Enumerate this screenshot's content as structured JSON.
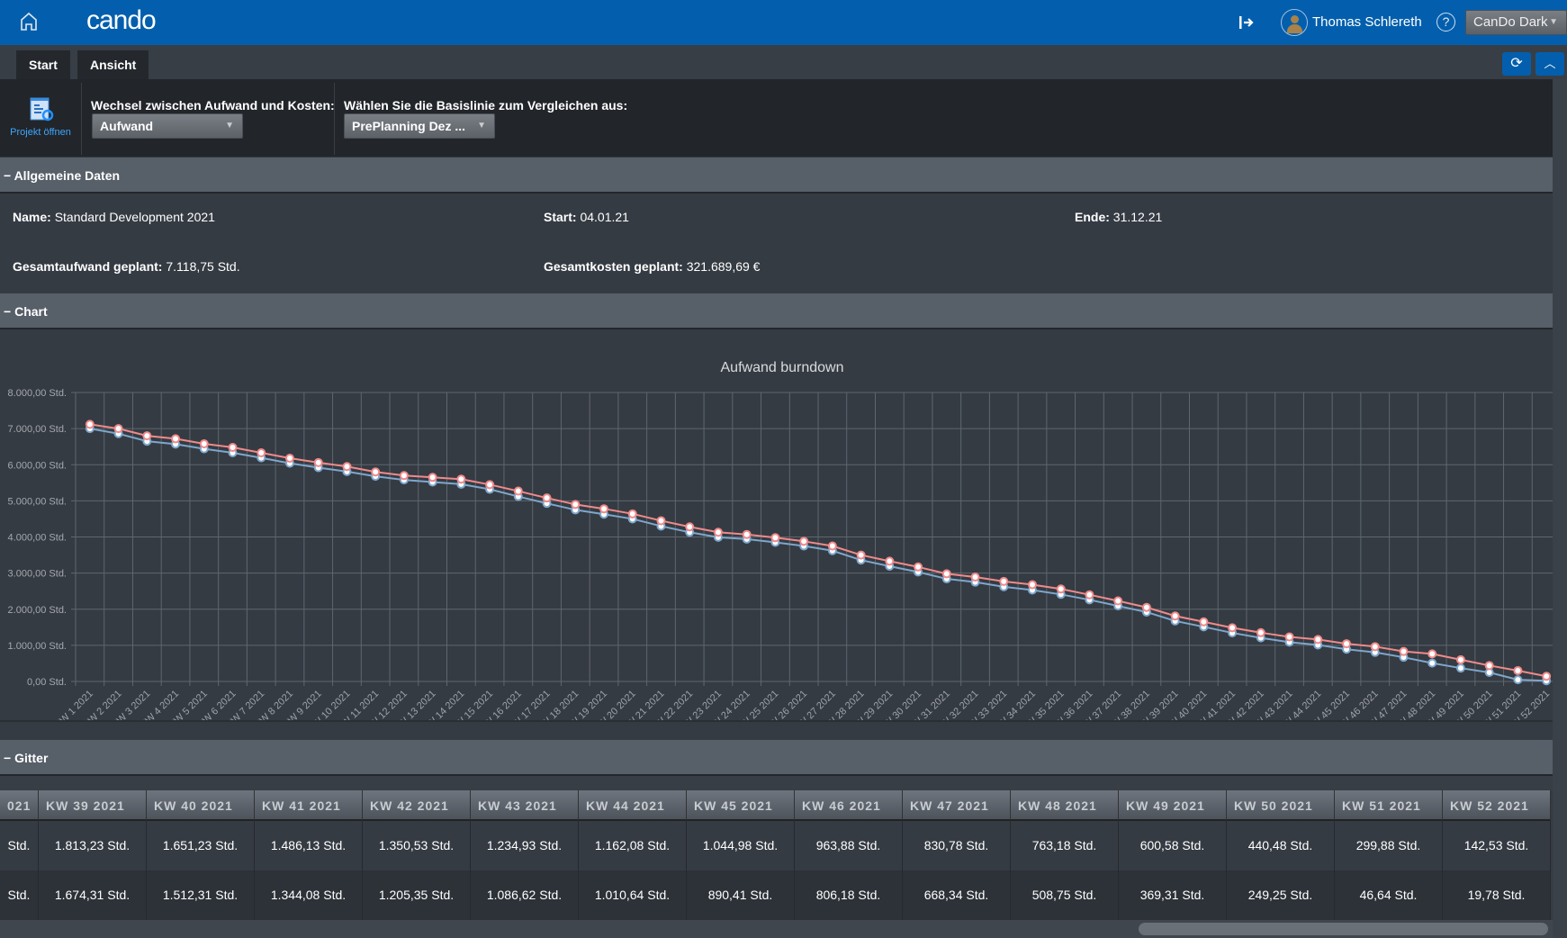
{
  "header": {
    "logo": "cando",
    "user_name": "Thomas Schlereth",
    "theme_select": "CanDo Dark",
    "icons": [
      "home-icon",
      "logout-icon",
      "user-avatar-icon",
      "help-icon"
    ]
  },
  "tabs": [
    {
      "label": "Start",
      "active": true
    },
    {
      "label": "Ansicht",
      "active": false
    }
  ],
  "ribbon": {
    "open_project_label": "Projekt öffnen",
    "switch_label": "Wechsel zwischen Aufwand und Kosten:",
    "switch_value": "Aufwand",
    "baseline_label": "Wählen Sie die Basislinie zum Vergleichen aus:",
    "baseline_value": "PrePlanning Dez ..."
  },
  "sections": {
    "general": "Allgemeine Daten",
    "chart": "Chart",
    "grid": "Gitter",
    "collapse_glyph": "−"
  },
  "general": {
    "name_label": "Name:",
    "name_value": "Standard Development 2021",
    "start_label": "Start:",
    "start_value": "04.01.21",
    "end_label": "Ende:",
    "end_value": "31.12.21",
    "effort_label": "Gesamtaufwand geplant:",
    "effort_value": "7.118,75 Std.",
    "cost_label": "Gesamtkosten geplant:",
    "cost_value": "321.689,69 €"
  },
  "colors": {
    "accent": "#035fad",
    "series_red": "#f08a8a",
    "series_blue": "#7ea7cc"
  },
  "chart_data": {
    "type": "line",
    "title": "Aufwand burndown",
    "xlabel": "",
    "ylabel": "",
    "ylim": [
      0,
      8000
    ],
    "grid": true,
    "ytick_labels": [
      "0,00 Std.",
      "1.000,00 Std.",
      "2.000,00 Std.",
      "3.000,00 Std.",
      "4.000,00 Std.",
      "5.000,00 Std.",
      "6.000,00 Std.",
      "7.000,00 Std.",
      "8.000,00 Std."
    ],
    "yticks": [
      0,
      1000,
      2000,
      3000,
      4000,
      5000,
      6000,
      7000,
      8000
    ],
    "categories": [
      "KW 1 2021",
      "KW 2 2021",
      "KW 3 2021",
      "KW 4 2021",
      "KW 5 2021",
      "KW 6 2021",
      "KW 7 2021",
      "KW 8 2021",
      "KW 9 2021",
      "KW 10 2021",
      "KW 11 2021",
      "KW 12 2021",
      "KW 13 2021",
      "KW 14 2021",
      "KW 15 2021",
      "KW 16 2021",
      "KW 17 2021",
      "KW 18 2021",
      "KW 19 2021",
      "KW 20 2021",
      "KW 21 2021",
      "KW 22 2021",
      "KW 23 2021",
      "KW 24 2021",
      "KW 25 2021",
      "KW 26 2021",
      "KW 27 2021",
      "KW 28 2021",
      "KW 29 2021",
      "KW 30 2021",
      "KW 31 2021",
      "KW 32 2021",
      "KW 33 2021",
      "KW 34 2021",
      "KW 35 2021",
      "KW 36 2021",
      "KW 37 2021",
      "KW 38 2021",
      "KW 39 2021",
      "KW 40 2021",
      "KW 41 2021",
      "KW 42 2021",
      "KW 43 2021",
      "KW 44 2021",
      "KW 45 2021",
      "KW 46 2021",
      "KW 47 2021",
      "KW 48 2021",
      "KW 49 2021",
      "KW 50 2021",
      "KW 51 2021",
      "KW 52 2021"
    ],
    "series": [
      {
        "color": "#f08a8a",
        "values": [
          7118.75,
          7000,
          6800,
          6720,
          6580,
          6480,
          6330,
          6180,
          6060,
          5950,
          5800,
          5700,
          5650,
          5600,
          5450,
          5270,
          5080,
          4900,
          4780,
          4640,
          4450,
          4280,
          4130,
          4070,
          3980,
          3880,
          3750,
          3500,
          3330,
          3170,
          2980,
          2890,
          2770,
          2680,
          2560,
          2400,
          2230,
          2050,
          1813.23,
          1651.23,
          1486.13,
          1350.53,
          1234.93,
          1162.08,
          1044.98,
          963.88,
          830.78,
          763.18,
          600.58,
          440.48,
          299.88,
          142.53
        ]
      },
      {
        "color": "#7ea7cc",
        "values": [
          7000,
          6860,
          6650,
          6570,
          6440,
          6330,
          6190,
          6040,
          5920,
          5810,
          5680,
          5580,
          5520,
          5460,
          5320,
          5120,
          4930,
          4750,
          4630,
          4500,
          4300,
          4130,
          3990,
          3940,
          3850,
          3750,
          3620,
          3360,
          3190,
          3030,
          2840,
          2750,
          2620,
          2530,
          2410,
          2260,
          2090,
          1920,
          1674.31,
          1512.31,
          1344.08,
          1205.35,
          1086.62,
          1010.64,
          890.41,
          806.18,
          668.34,
          508.75,
          369.31,
          249.25,
          46.64,
          19.78
        ]
      }
    ]
  },
  "grid": {
    "partial_column": {
      "header": "021",
      "row1": "Std.",
      "row2": "Std."
    },
    "columns": [
      "KW 39 2021",
      "KW 40 2021",
      "KW 41 2021",
      "KW 42 2021",
      "KW 43 2021",
      "KW 44 2021",
      "KW 45 2021",
      "KW 46 2021",
      "KW 47 2021",
      "KW 48 2021",
      "KW 49 2021",
      "KW 50 2021",
      "KW 51 2021",
      "KW 52 2021"
    ],
    "rows": [
      [
        "1.813,23 Std.",
        "1.651,23 Std.",
        "1.486,13 Std.",
        "1.350,53 Std.",
        "1.234,93 Std.",
        "1.162,08 Std.",
        "1.044,98 Std.",
        "963,88 Std.",
        "830,78 Std.",
        "763,18 Std.",
        "600,58 Std.",
        "440,48 Std.",
        "299,88 Std.",
        "142,53 Std."
      ],
      [
        "1.674,31 Std.",
        "1.512,31 Std.",
        "1.344,08 Std.",
        "1.205,35 Std.",
        "1.086,62 Std.",
        "1.010,64 Std.",
        "890,41 Std.",
        "806,18 Std.",
        "668,34 Std.",
        "508,75 Std.",
        "369,31 Std.",
        "249,25 Std.",
        "46,64 Std.",
        "19,78 Std."
      ]
    ]
  }
}
